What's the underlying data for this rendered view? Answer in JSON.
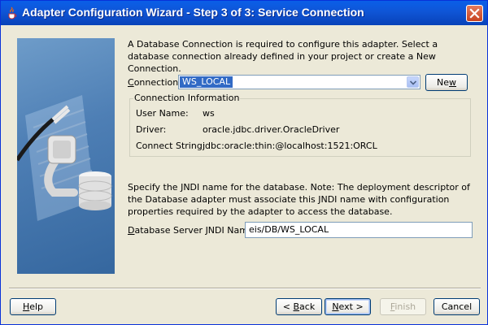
{
  "window": {
    "title": "Adapter Configuration Wizard - Step 3 of 3: Service Connection"
  },
  "intro": {
    "text": "A Database Connection is required to configure this adapter. Select a database connection already defined in your project or create a New Connection."
  },
  "connection": {
    "label_prefix": "C",
    "label_rest": "onnection:",
    "selected": "WS_LOCAL",
    "new_button_prefix": "Ne",
    "new_button_u": "w"
  },
  "connection_info": {
    "title": "Connection Information",
    "rows": [
      {
        "label": "User Name:",
        "value": "ws"
      },
      {
        "label": "Driver:",
        "value": "oracle.jdbc.driver.OracleDriver"
      },
      {
        "label": "Connect String:",
        "value": "jdbc:oracle:thin:@localhost:1521:ORCL"
      }
    ]
  },
  "jndi": {
    "note": "Specify the JNDI name for the database.  Note: The deployment descriptor of the Database adapter must associate this JNDI name with configuration properties required by the adapter to access the database.",
    "label_prefix": "D",
    "label_rest": "atabase Server JNDI Name:",
    "value": "eis/DB/WS_LOCAL"
  },
  "buttons": {
    "help_u": "H",
    "help_rest": "elp",
    "back_pre": "< ",
    "back_u": "B",
    "back_rest": "ack",
    "next_u": "N",
    "next_rest": "ext >",
    "finish_u": "F",
    "finish_rest": "inish",
    "cancel": "Cancel"
  },
  "colors": {
    "titlebar": "#0a5fe8",
    "selection": "#316ac5",
    "dialog_bg": "#ece9d8"
  }
}
